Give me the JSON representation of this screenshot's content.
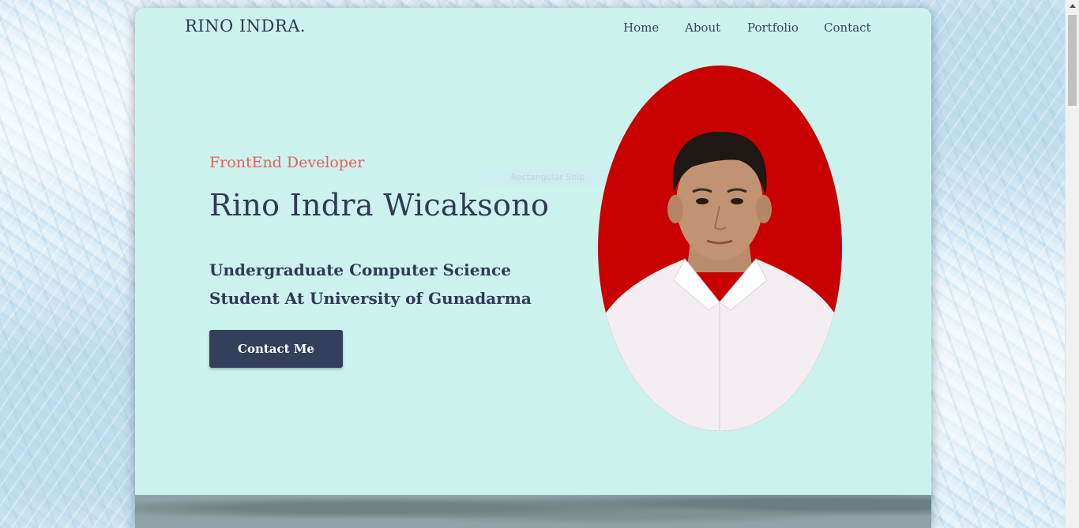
{
  "nav": {
    "brand": "RINO INDRA.",
    "links": [
      "Home",
      "About",
      "Portfolio",
      "Contact"
    ]
  },
  "hero": {
    "subtitle": "FrontEnd Developer",
    "name": "Rino Indra Wicaksono",
    "description_line1": "Undergraduate Computer Science",
    "description_line2": "Student At University of Gunadarma",
    "button_label": "Contact Me"
  },
  "overlay": {
    "snip_label": "Rectangular Snip"
  },
  "icons": {
    "photo": "profile-photo"
  },
  "colors": {
    "card_background": "#ccf2ed",
    "accent": "#ef5b5b",
    "text_dark": "#2f3a55",
    "button_background": "#343f5c",
    "photo_background": "#c80000"
  }
}
